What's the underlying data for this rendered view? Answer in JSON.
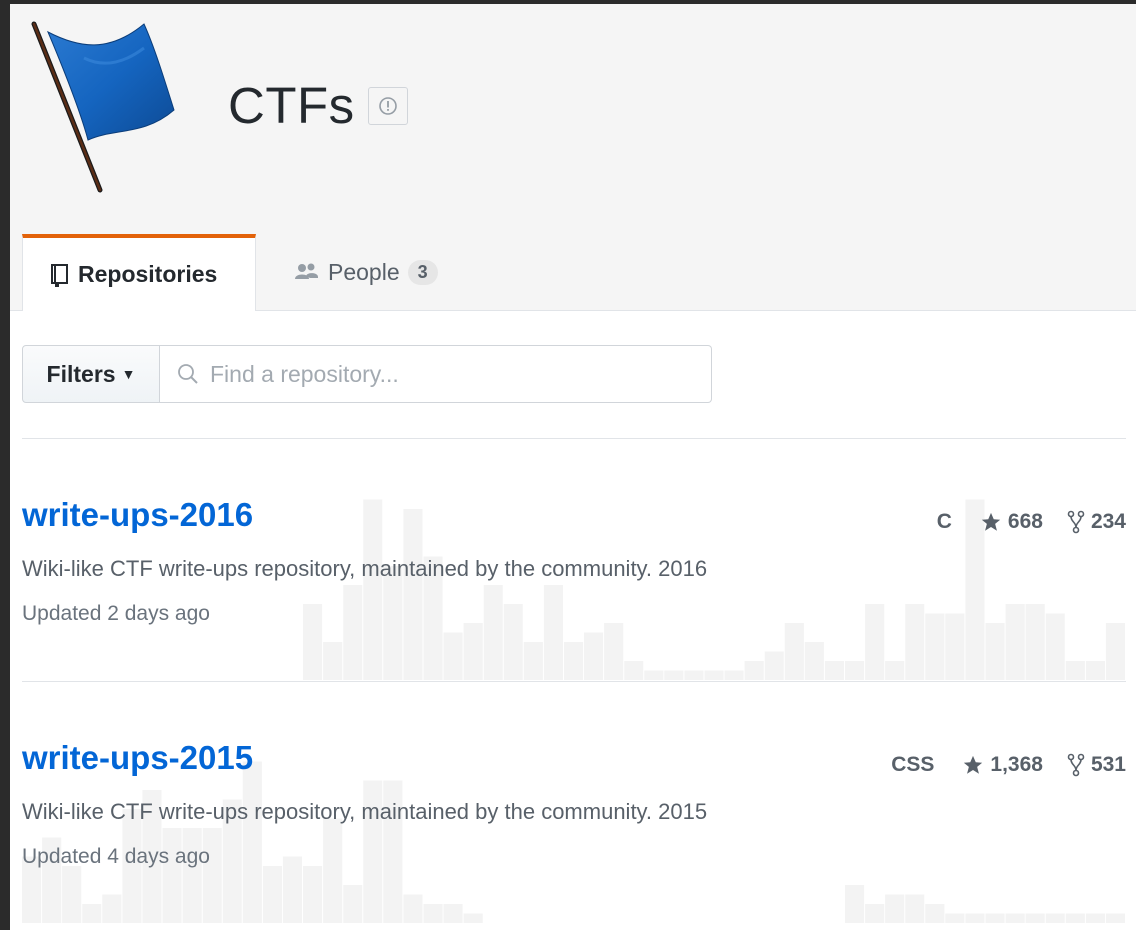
{
  "org": {
    "name": "CTFs"
  },
  "tabs": [
    {
      "label": "Repositories"
    },
    {
      "label": "People",
      "count": "3"
    }
  ],
  "filters": {
    "button_label": "Filters",
    "search_placeholder": "Find a repository..."
  },
  "repos": [
    {
      "name": "write-ups-2016",
      "description": "Wiki-like CTF write-ups repository, maintained by the community. 2016",
      "updated": "Updated 2 days ago",
      "language": "C",
      "stars": "668",
      "forks": "234",
      "activity": [
        0,
        0,
        0,
        0,
        0,
        0,
        0,
        0,
        0,
        0,
        0,
        0,
        0,
        0,
        0.4,
        0.2,
        0.5,
        0.95,
        0.6,
        0.9,
        0.65,
        0.25,
        0.3,
        0.5,
        0.4,
        0.2,
        0.5,
        0.2,
        0.25,
        0.3,
        0.1,
        0.05,
        0.05,
        0.05,
        0.05,
        0.05,
        0.1,
        0.15,
        0.3,
        0.2,
        0.1,
        0.1,
        0.4,
        0.1,
        0.4,
        0.35,
        0.35,
        0.95,
        0.3,
        0.4,
        0.4,
        0.35,
        0.1,
        0.1,
        0.3
      ]
    },
    {
      "name": "write-ups-2015",
      "description": "Wiki-like CTF write-ups repository, maintained by the community. 2015",
      "updated": "Updated 4 days ago",
      "language": "CSS",
      "stars": "1,368",
      "forks": "531",
      "activity": [
        0.35,
        0.45,
        0.3,
        0.1,
        0.15,
        0.6,
        0.7,
        0.5,
        0.5,
        0.5,
        0.65,
        0.85,
        0.3,
        0.35,
        0.3,
        0.55,
        0.2,
        0.75,
        0.75,
        0.15,
        0.1,
        0.1,
        0.05,
        0,
        0,
        0,
        0,
        0,
        0,
        0,
        0,
        0,
        0,
        0,
        0,
        0,
        0,
        0,
        0,
        0,
        0,
        0.2,
        0.1,
        0.15,
        0.15,
        0.1,
        0.05,
        0.05,
        0.05,
        0.05,
        0.05,
        0.05,
        0.05,
        0.05,
        0.05
      ]
    }
  ],
  "colors": {
    "accent_tab": "#e36209",
    "link": "#0366d6",
    "flag_blue": "#1565c0"
  }
}
